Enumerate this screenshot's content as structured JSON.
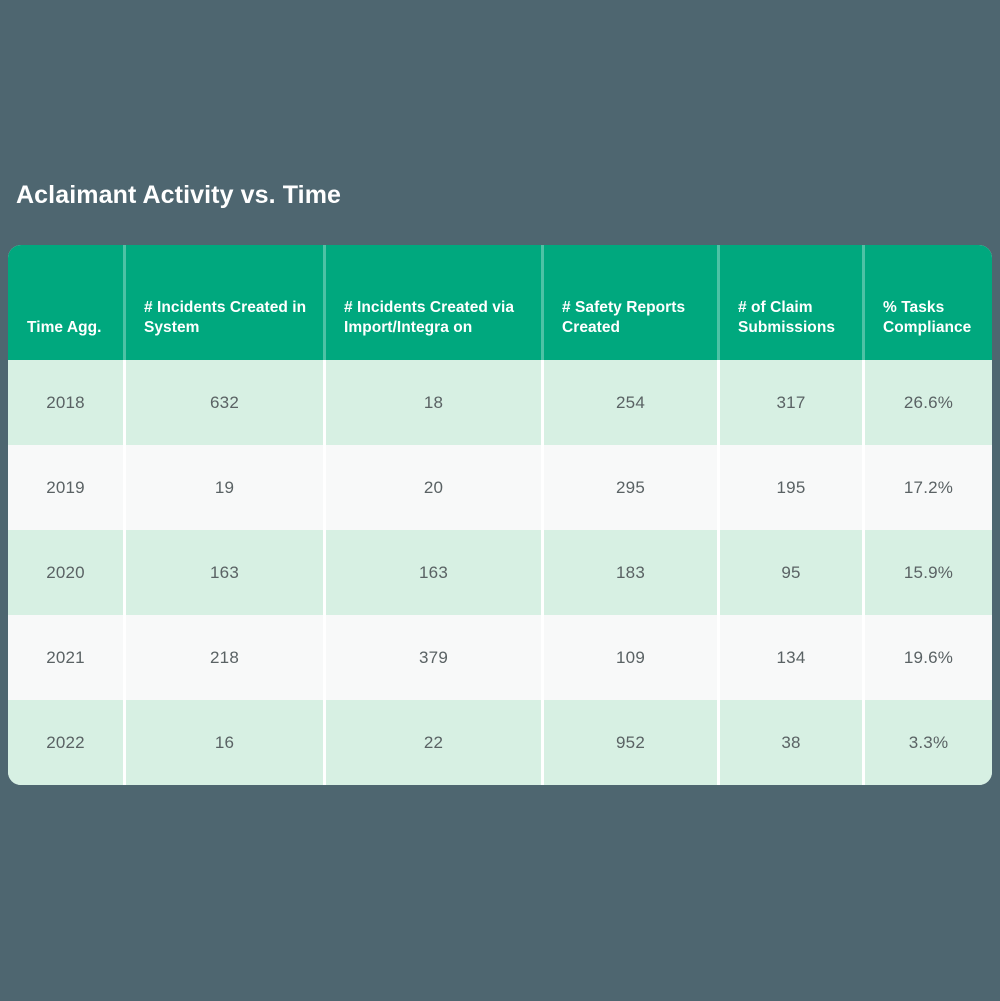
{
  "page": {
    "background_color": "#4e6670"
  },
  "title": "Aclaimant Activity vs. Time",
  "table": {
    "accent_header_color": "#00a87e",
    "row_alt_color": "#d7f0e3",
    "row_base_color": "#f8f9f9",
    "text_color": "#5a6264",
    "columns": [
      {
        "id": "time_agg",
        "label": "Time Agg."
      },
      {
        "id": "incidents_system",
        "label": "# Incidents Created in System"
      },
      {
        "id": "incidents_import",
        "label": "# Incidents Created via Import/Integra on"
      },
      {
        "id": "safety_reports",
        "label": "# Safety Reports Created"
      },
      {
        "id": "claim_submissions",
        "label": "# of Claim Submissions"
      },
      {
        "id": "tasks_compliance",
        "label": "% Tasks Compliance"
      }
    ],
    "rows": [
      {
        "time_agg": "2018",
        "incidents_system": "632",
        "incidents_import": "18",
        "safety_reports": "254",
        "claim_submissions": "317",
        "tasks_compliance": "26.6%"
      },
      {
        "time_agg": "2019",
        "incidents_system": "19",
        "incidents_import": "20",
        "safety_reports": "295",
        "claim_submissions": "195",
        "tasks_compliance": "17.2%"
      },
      {
        "time_agg": "2020",
        "incidents_system": "163",
        "incidents_import": "163",
        "safety_reports": "183",
        "claim_submissions": "95",
        "tasks_compliance": "15.9%"
      },
      {
        "time_agg": "2021",
        "incidents_system": "218",
        "incidents_import": "379",
        "safety_reports": "109",
        "claim_submissions": "134",
        "tasks_compliance": "19.6%"
      },
      {
        "time_agg": "2022",
        "incidents_system": "16",
        "incidents_import": "22",
        "safety_reports": "952",
        "claim_submissions": "38",
        "tasks_compliance": "3.3%"
      }
    ]
  },
  "chart_data": {
    "type": "table",
    "title": "Aclaimant Activity vs. Time",
    "xlabel": "Time Agg.",
    "ylabel": "",
    "categories": [
      "2018",
      "2019",
      "2020",
      "2021",
      "2022"
    ],
    "columns": [
      "Time Agg.",
      "# Incidents Created in System",
      "# Incidents Created via Import/Integra on",
      "# Safety Reports Created",
      "# of Claim Submissions",
      "% Tasks Compliance"
    ],
    "series": [
      {
        "name": "# Incidents Created in System",
        "values": [
          632,
          19,
          163,
          218,
          16
        ]
      },
      {
        "name": "# Incidents Created via Import/Integra on",
        "values": [
          18,
          20,
          163,
          379,
          22
        ]
      },
      {
        "name": "# Safety Reports Created",
        "values": [
          254,
          295,
          183,
          109,
          952
        ]
      },
      {
        "name": "# of Claim Submissions",
        "values": [
          317,
          195,
          95,
          134,
          38
        ]
      },
      {
        "name": "% Tasks Compliance",
        "values": [
          26.6,
          17.2,
          15.9,
          19.6,
          3.3
        ]
      }
    ],
    "legend_position": "none",
    "grid": false
  }
}
